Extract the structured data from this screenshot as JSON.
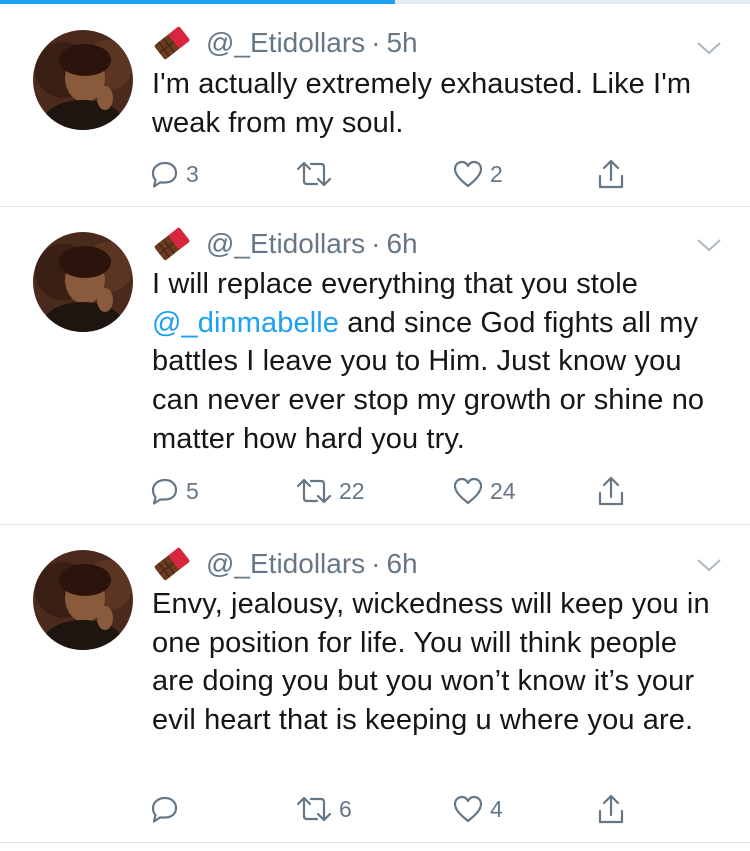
{
  "colors": {
    "link": "#1da1f2",
    "secondary": "#657786",
    "text": "#14171a",
    "divider": "#dfe3e8"
  },
  "tweets": [
    {
      "handle": "@_Etidollars",
      "separator": "·",
      "time": "5h",
      "text": "I'm actually extremely exhausted. Like I'm weak from my soul.",
      "reply_count": "3",
      "retweet_count": "",
      "like_count": "2"
    },
    {
      "handle": "@_Etidollars",
      "separator": "·",
      "time": "6h",
      "mention": "@_dinmabelle",
      "text_before": "I will replace everything that you stole ",
      "text_after": " and since God fights all my battles I leave you to Him. Just know you can never ever stop my growth or shine no matter how hard you try.",
      "reply_count": "5",
      "retweet_count": "22",
      "like_count": "24"
    },
    {
      "handle": "@_Etidollars",
      "separator": "·",
      "time": "6h",
      "text": "Envy, jealousy, wickedness will keep you in one position for life. You will think people are doing you but you won’t know it’s your evil heart that is keeping u where you are.",
      "reply_count": "",
      "retweet_count": "6",
      "like_count": "4"
    }
  ],
  "icons": {
    "avatar": "avatar",
    "emoji": "chocolate-bar-emoji",
    "caret": "chevron-down-icon",
    "reply": "reply-icon",
    "retweet": "retweet-icon",
    "like": "heart-icon",
    "share": "share-icon"
  }
}
